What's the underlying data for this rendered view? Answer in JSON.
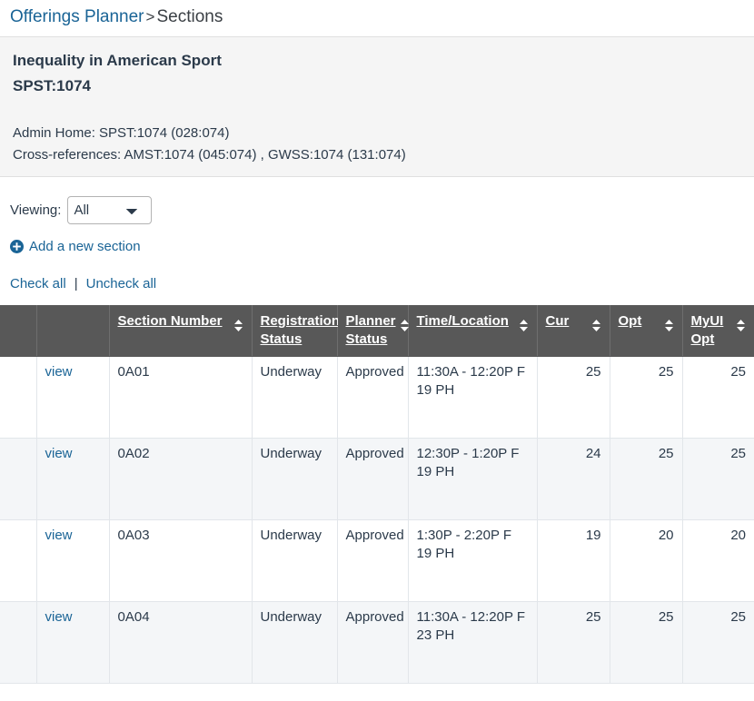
{
  "breadcrumb": {
    "root_label": "Offerings Planner",
    "separator": ">",
    "current_label": "Sections"
  },
  "course": {
    "title": "Inequality in American Sport",
    "code": "SPST:1074",
    "admin_home": "Admin Home: SPST:1074 (028:074)",
    "cross_references": "Cross-references: AMST:1074 (045:074) , GWSS:1074 (131:074)"
  },
  "filter": {
    "label": "Viewing:",
    "selected": "All",
    "options": [
      "All"
    ]
  },
  "actions": {
    "add_section_label": "Add a new section",
    "add_section_icon": "plus-circle-icon",
    "check_all_label": "Check all",
    "separator": "|",
    "uncheck_all_label": "Uncheck all"
  },
  "table": {
    "sort_icon": "sort-updown-icon",
    "columns": [
      {
        "key": "checkbox",
        "label": "",
        "sortable": false,
        "align": "left"
      },
      {
        "key": "view",
        "label": "",
        "sortable": false,
        "align": "left"
      },
      {
        "key": "section_number",
        "label": "Section Number",
        "sortable": true,
        "align": "left"
      },
      {
        "key": "registration_status",
        "label": "Registration Status",
        "sortable": true,
        "align": "left"
      },
      {
        "key": "planner_status",
        "label": "Planner Status",
        "sortable": true,
        "align": "left"
      },
      {
        "key": "time_location",
        "label": "Time/Location",
        "sortable": true,
        "align": "left"
      },
      {
        "key": "cur",
        "label": "Cur",
        "sortable": true,
        "align": "right"
      },
      {
        "key": "opt",
        "label": "Opt",
        "sortable": true,
        "align": "right"
      },
      {
        "key": "myui_opt",
        "label": "MyUI Opt",
        "sortable": true,
        "align": "right"
      }
    ],
    "rows": [
      {
        "view_label": "view",
        "section_number": "0A01",
        "registration_status": "Underway",
        "planner_status": "Approved",
        "time": "11:30A - 12:20P F",
        "location": "19 PH",
        "cur": "25",
        "opt": "25",
        "myui_opt": "25"
      },
      {
        "view_label": "view",
        "section_number": "0A02",
        "registration_status": "Underway",
        "planner_status": "Approved",
        "time": "12:30P - 1:20P F",
        "location": "19 PH",
        "cur": "24",
        "opt": "25",
        "myui_opt": "25"
      },
      {
        "view_label": "view",
        "section_number": "0A03",
        "registration_status": "Underway",
        "planner_status": "Approved",
        "time": "1:30P - 2:20P F",
        "location": "19 PH",
        "cur": "19",
        "opt": "20",
        "myui_opt": "20"
      },
      {
        "view_label": "view",
        "section_number": "0A04",
        "registration_status": "Underway",
        "planner_status": "Approved",
        "time": "11:30A - 12:20P F",
        "location": "23 PH",
        "cur": "25",
        "opt": "25",
        "myui_opt": "25"
      }
    ]
  },
  "colors": {
    "link": "#1a6496",
    "header_bg": "#585858",
    "panel_bg": "#f5f5f5",
    "status_underway": "#ac4a3c",
    "text": "#2b3a4a"
  }
}
